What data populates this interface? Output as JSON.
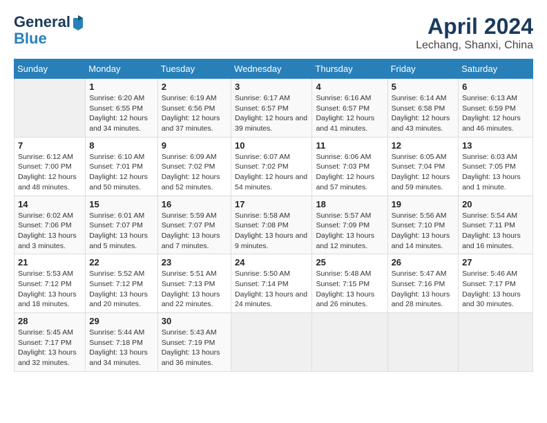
{
  "header": {
    "logo_line1": "General",
    "logo_line2": "Blue",
    "title": "April 2024",
    "subtitle": "Lechang, Shanxi, China"
  },
  "weekdays": [
    "Sunday",
    "Monday",
    "Tuesday",
    "Wednesday",
    "Thursday",
    "Friday",
    "Saturday"
  ],
  "weeks": [
    [
      {
        "day": "",
        "sunrise": "",
        "sunset": "",
        "daylight": ""
      },
      {
        "day": "1",
        "sunrise": "Sunrise: 6:20 AM",
        "sunset": "Sunset: 6:55 PM",
        "daylight": "Daylight: 12 hours and 34 minutes."
      },
      {
        "day": "2",
        "sunrise": "Sunrise: 6:19 AM",
        "sunset": "Sunset: 6:56 PM",
        "daylight": "Daylight: 12 hours and 37 minutes."
      },
      {
        "day": "3",
        "sunrise": "Sunrise: 6:17 AM",
        "sunset": "Sunset: 6:57 PM",
        "daylight": "Daylight: 12 hours and 39 minutes."
      },
      {
        "day": "4",
        "sunrise": "Sunrise: 6:16 AM",
        "sunset": "Sunset: 6:57 PM",
        "daylight": "Daylight: 12 hours and 41 minutes."
      },
      {
        "day": "5",
        "sunrise": "Sunrise: 6:14 AM",
        "sunset": "Sunset: 6:58 PM",
        "daylight": "Daylight: 12 hours and 43 minutes."
      },
      {
        "day": "6",
        "sunrise": "Sunrise: 6:13 AM",
        "sunset": "Sunset: 6:59 PM",
        "daylight": "Daylight: 12 hours and 46 minutes."
      }
    ],
    [
      {
        "day": "7",
        "sunrise": "Sunrise: 6:12 AM",
        "sunset": "Sunset: 7:00 PM",
        "daylight": "Daylight: 12 hours and 48 minutes."
      },
      {
        "day": "8",
        "sunrise": "Sunrise: 6:10 AM",
        "sunset": "Sunset: 7:01 PM",
        "daylight": "Daylight: 12 hours and 50 minutes."
      },
      {
        "day": "9",
        "sunrise": "Sunrise: 6:09 AM",
        "sunset": "Sunset: 7:02 PM",
        "daylight": "Daylight: 12 hours and 52 minutes."
      },
      {
        "day": "10",
        "sunrise": "Sunrise: 6:07 AM",
        "sunset": "Sunset: 7:02 PM",
        "daylight": "Daylight: 12 hours and 54 minutes."
      },
      {
        "day": "11",
        "sunrise": "Sunrise: 6:06 AM",
        "sunset": "Sunset: 7:03 PM",
        "daylight": "Daylight: 12 hours and 57 minutes."
      },
      {
        "day": "12",
        "sunrise": "Sunrise: 6:05 AM",
        "sunset": "Sunset: 7:04 PM",
        "daylight": "Daylight: 12 hours and 59 minutes."
      },
      {
        "day": "13",
        "sunrise": "Sunrise: 6:03 AM",
        "sunset": "Sunset: 7:05 PM",
        "daylight": "Daylight: 13 hours and 1 minute."
      }
    ],
    [
      {
        "day": "14",
        "sunrise": "Sunrise: 6:02 AM",
        "sunset": "Sunset: 7:06 PM",
        "daylight": "Daylight: 13 hours and 3 minutes."
      },
      {
        "day": "15",
        "sunrise": "Sunrise: 6:01 AM",
        "sunset": "Sunset: 7:07 PM",
        "daylight": "Daylight: 13 hours and 5 minutes."
      },
      {
        "day": "16",
        "sunrise": "Sunrise: 5:59 AM",
        "sunset": "Sunset: 7:07 PM",
        "daylight": "Daylight: 13 hours and 7 minutes."
      },
      {
        "day": "17",
        "sunrise": "Sunrise: 5:58 AM",
        "sunset": "Sunset: 7:08 PM",
        "daylight": "Daylight: 13 hours and 9 minutes."
      },
      {
        "day": "18",
        "sunrise": "Sunrise: 5:57 AM",
        "sunset": "Sunset: 7:09 PM",
        "daylight": "Daylight: 13 hours and 12 minutes."
      },
      {
        "day": "19",
        "sunrise": "Sunrise: 5:56 AM",
        "sunset": "Sunset: 7:10 PM",
        "daylight": "Daylight: 13 hours and 14 minutes."
      },
      {
        "day": "20",
        "sunrise": "Sunrise: 5:54 AM",
        "sunset": "Sunset: 7:11 PM",
        "daylight": "Daylight: 13 hours and 16 minutes."
      }
    ],
    [
      {
        "day": "21",
        "sunrise": "Sunrise: 5:53 AM",
        "sunset": "Sunset: 7:12 PM",
        "daylight": "Daylight: 13 hours and 18 minutes."
      },
      {
        "day": "22",
        "sunrise": "Sunrise: 5:52 AM",
        "sunset": "Sunset: 7:12 PM",
        "daylight": "Daylight: 13 hours and 20 minutes."
      },
      {
        "day": "23",
        "sunrise": "Sunrise: 5:51 AM",
        "sunset": "Sunset: 7:13 PM",
        "daylight": "Daylight: 13 hours and 22 minutes."
      },
      {
        "day": "24",
        "sunrise": "Sunrise: 5:50 AM",
        "sunset": "Sunset: 7:14 PM",
        "daylight": "Daylight: 13 hours and 24 minutes."
      },
      {
        "day": "25",
        "sunrise": "Sunrise: 5:48 AM",
        "sunset": "Sunset: 7:15 PM",
        "daylight": "Daylight: 13 hours and 26 minutes."
      },
      {
        "day": "26",
        "sunrise": "Sunrise: 5:47 AM",
        "sunset": "Sunset: 7:16 PM",
        "daylight": "Daylight: 13 hours and 28 minutes."
      },
      {
        "day": "27",
        "sunrise": "Sunrise: 5:46 AM",
        "sunset": "Sunset: 7:17 PM",
        "daylight": "Daylight: 13 hours and 30 minutes."
      }
    ],
    [
      {
        "day": "28",
        "sunrise": "Sunrise: 5:45 AM",
        "sunset": "Sunset: 7:17 PM",
        "daylight": "Daylight: 13 hours and 32 minutes."
      },
      {
        "day": "29",
        "sunrise": "Sunrise: 5:44 AM",
        "sunset": "Sunset: 7:18 PM",
        "daylight": "Daylight: 13 hours and 34 minutes."
      },
      {
        "day": "30",
        "sunrise": "Sunrise: 5:43 AM",
        "sunset": "Sunset: 7:19 PM",
        "daylight": "Daylight: 13 hours and 36 minutes."
      },
      {
        "day": "",
        "sunrise": "",
        "sunset": "",
        "daylight": ""
      },
      {
        "day": "",
        "sunrise": "",
        "sunset": "",
        "daylight": ""
      },
      {
        "day": "",
        "sunrise": "",
        "sunset": "",
        "daylight": ""
      },
      {
        "day": "",
        "sunrise": "",
        "sunset": "",
        "daylight": ""
      }
    ]
  ]
}
